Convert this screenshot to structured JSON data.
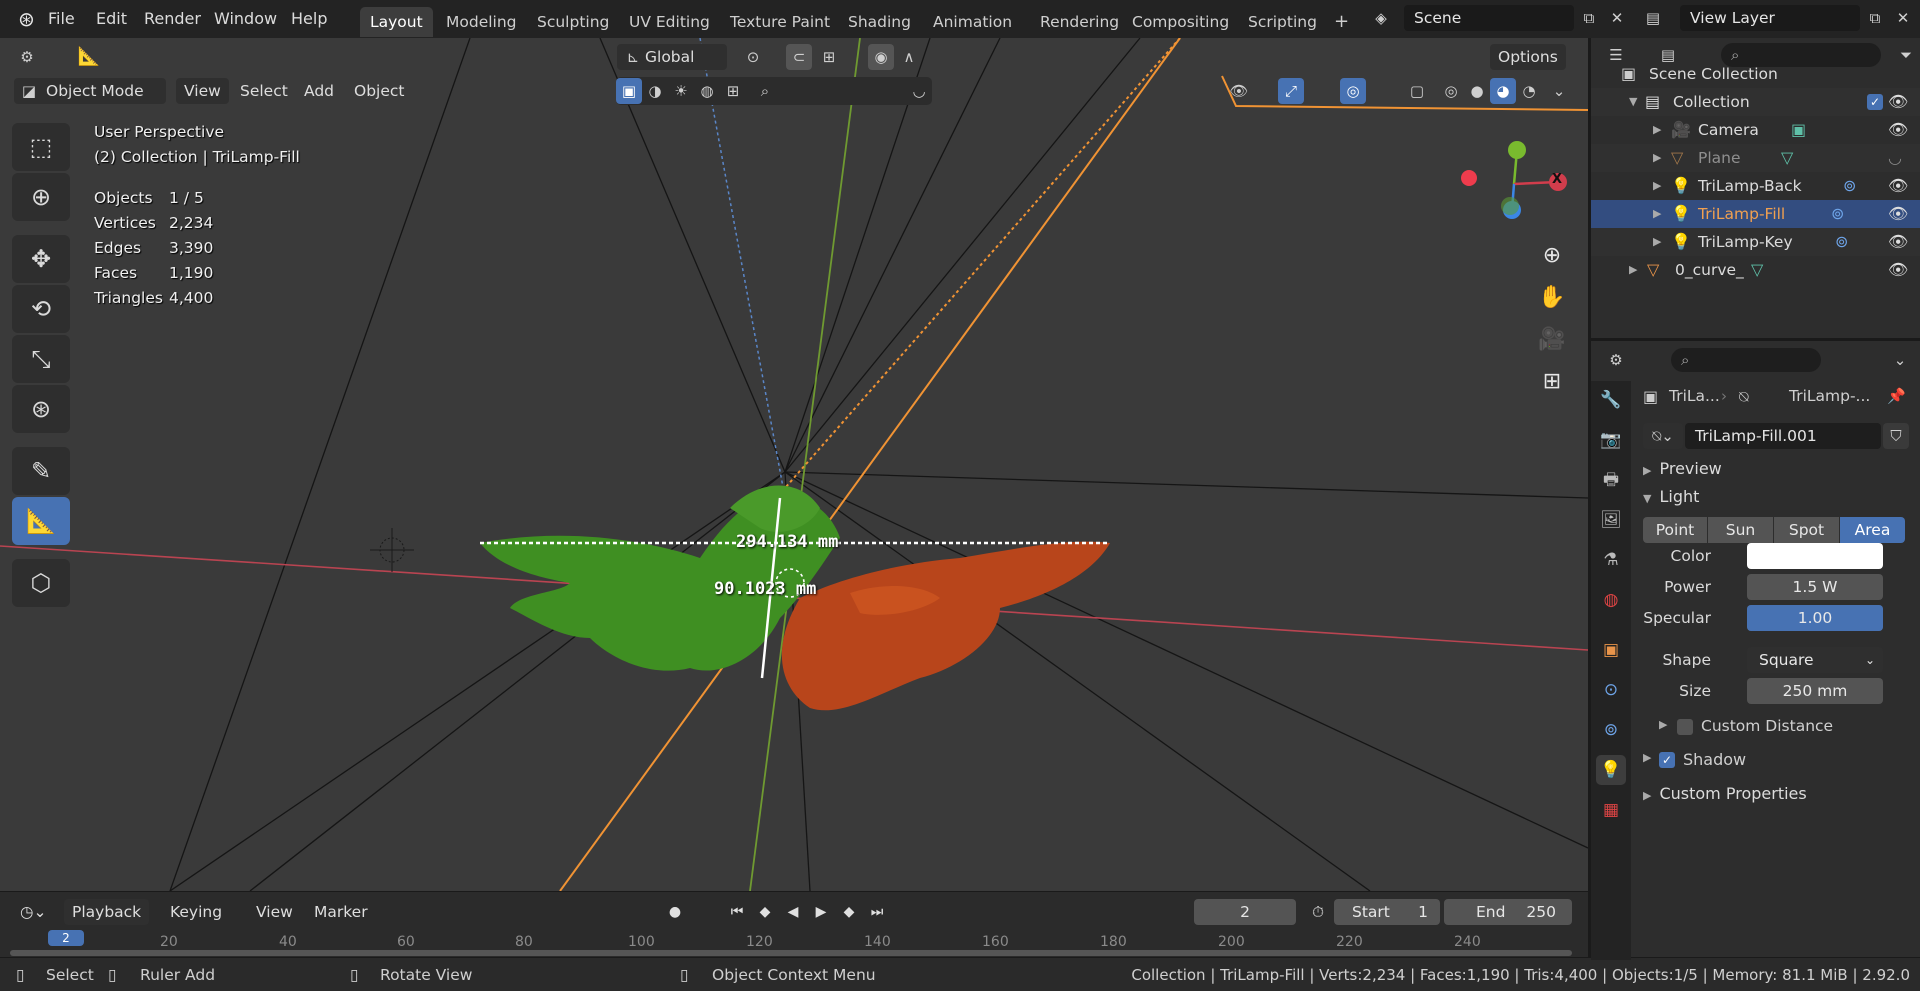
{
  "topbar": {
    "menus": [
      "File",
      "Edit",
      "Render",
      "Window",
      "Help"
    ],
    "workspaces": [
      "Layout",
      "Modeling",
      "Sculpting",
      "UV Editing",
      "Texture Paint",
      "Shading",
      "Animation",
      "Rendering",
      "Compositing",
      "Scripting"
    ],
    "active_workspace": "Layout",
    "add_workspace": "+",
    "scene": "Scene",
    "view_layer": "View Layer"
  },
  "viewport": {
    "mode": "Object Mode",
    "menus": [
      "View",
      "Select",
      "Add",
      "Object"
    ],
    "transform_orientation": "Global",
    "options": "Options",
    "overlay_title": "User Perspective",
    "overlay_subtitle": "(2) Collection | TriLamp-Fill",
    "stats": [
      {
        "label": "Objects",
        "value": "1 / 5"
      },
      {
        "label": "Vertices",
        "value": "2,234"
      },
      {
        "label": "Edges",
        "value": "3,390"
      },
      {
        "label": "Faces",
        "value": "1,190"
      },
      {
        "label": "Triangles",
        "value": "4,400"
      }
    ],
    "measure_1": "294.134 mm",
    "measure_2": "90.1023 mm",
    "gizmo_x": "X",
    "colors": {
      "x_axis": "#d13d4c",
      "y_axis": "#79ba2e",
      "z_axis": "#3b87e6",
      "accent": "#4772b3"
    }
  },
  "tools": [
    "select-box",
    "cursor",
    "move",
    "rotate",
    "scale",
    "transform",
    "annotate",
    "measure",
    "add-cube"
  ],
  "timeline": {
    "playback": "Playback",
    "keying": "Keying",
    "view": "View",
    "marker": "Marker",
    "current_frame": "2",
    "start_label": "Start",
    "start": "1",
    "end_label": "End",
    "end": "250",
    "ruler": [
      "2",
      "20",
      "40",
      "60",
      "80",
      "100",
      "120",
      "140",
      "160",
      "180",
      "200",
      "220",
      "240"
    ]
  },
  "statusbar": {
    "select": "Select",
    "ruler_add": "Ruler Add",
    "rotate_view": "Rotate View",
    "context_menu": "Object Context Menu",
    "info": "Collection | TriLamp-Fill | Verts:2,234 | Faces:1,190 | Tris:4,400 | Objects:1/5 | Memory: 81.1 MiB | 2.92.0"
  },
  "outliner": {
    "scene_collection": "Scene Collection",
    "rows": [
      {
        "label": "Collection"
      },
      {
        "label": "Camera"
      },
      {
        "label": "Plane"
      },
      {
        "label": "TriLamp-Back"
      },
      {
        "label": "TriLamp-Fill"
      },
      {
        "label": "TriLamp-Key"
      },
      {
        "label": "0_curve_"
      }
    ]
  },
  "properties": {
    "breadcrumb_object": "TriLa...",
    "breadcrumb_data": "TriLamp-...",
    "datablock": "TriLamp-Fill.001",
    "panel_preview": "Preview",
    "panel_light": "Light",
    "light_types": [
      "Point",
      "Sun",
      "Spot",
      "Area"
    ],
    "active_light_type": "Area",
    "color_label": "Color",
    "color_value": "#ffffff",
    "power_label": "Power",
    "power_value": "1.5 W",
    "specular_label": "Specular",
    "specular_value": "1.00",
    "specular_fraction": 1.0,
    "shape_label": "Shape",
    "shape_value": "Square",
    "size_label": "Size",
    "size_value": "250 mm",
    "custom_distance": "Custom Distance",
    "shadow": "Shadow",
    "custom_properties": "Custom Properties"
  }
}
